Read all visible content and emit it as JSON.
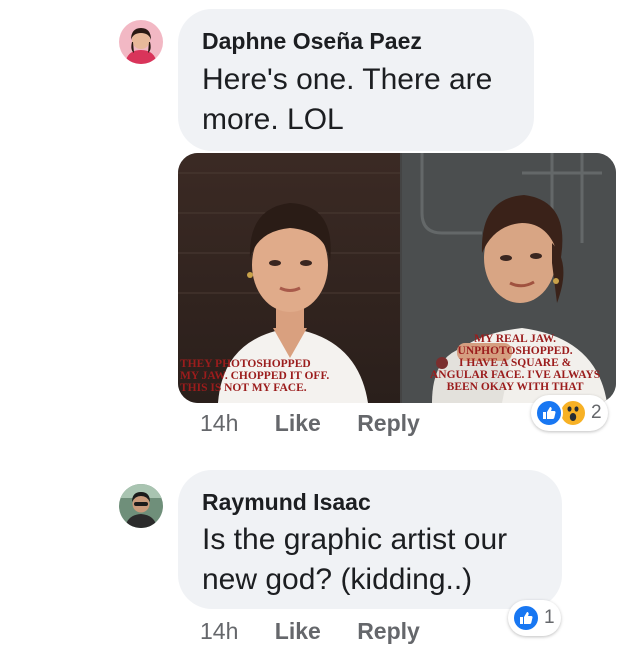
{
  "comments": [
    {
      "author": "Daphne Oseña Paez",
      "text_lines": [
        "Here's one. There are",
        "more. LOL"
      ],
      "attachment": {
        "left_caption": [
          "They photoshopped",
          "my jaw. Chopped it off.",
          "This is not my face."
        ],
        "right_caption": [
          "My real jaw.",
          "Unphotoshopped.",
          "I have a square &",
          "angular face. I've always",
          "been okay with that"
        ]
      },
      "time": "14h",
      "like_label": "Like",
      "reply_label": "Reply",
      "reactions": {
        "icons": [
          "like-icon",
          "wow-icon"
        ],
        "count": "2"
      }
    },
    {
      "author": "Raymund Isaac",
      "text_lines": [
        "Is the graphic artist our",
        "new god? (kidding..)"
      ],
      "time": "14h",
      "like_label": "Like",
      "reply_label": "Reply",
      "reactions": {
        "icons": [
          "like-icon"
        ],
        "count": "1"
      }
    }
  ],
  "colors": {
    "bubble": "#f0f2f5",
    "like_blue": "#1877f2",
    "wow_yellow": "#f7b125",
    "caption_red": "#9b1c1c"
  }
}
